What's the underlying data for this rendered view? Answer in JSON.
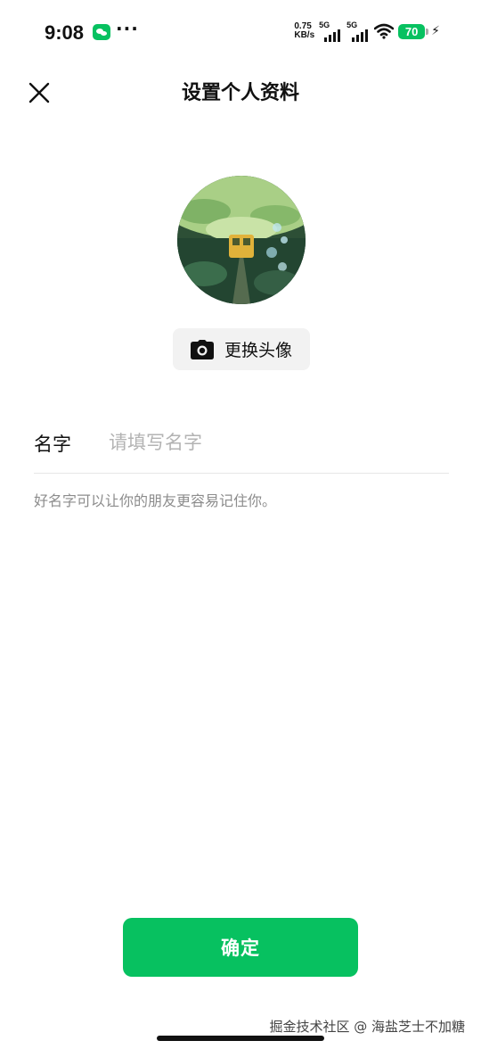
{
  "status_bar": {
    "time": "9:08",
    "more": "···",
    "speed_value": "0.75",
    "speed_unit": "KB/s",
    "sim1_tag": "5G",
    "sim2_tag": "5G",
    "battery": "70",
    "icons": [
      "wechat-icon",
      "signal-icon",
      "wifi-icon",
      "battery-icon",
      "charging-icon"
    ]
  },
  "header": {
    "title": "设置个人资料",
    "close_icon": "close-icon"
  },
  "avatar": {
    "change_label": "更换头像",
    "camera_icon": "camera-icon"
  },
  "form": {
    "name_label": "名字",
    "name_value": "",
    "name_placeholder": "请填写名字",
    "hint": "好名字可以让你的朋友更容易记住你。"
  },
  "footer": {
    "confirm_label": "确定",
    "watermark": "掘金技术社区 @ 海盐芝士不加糖"
  },
  "colors": {
    "accent": "#07c160",
    "hint": "#8c8c8c",
    "placeholder": "#b3b3b3"
  }
}
